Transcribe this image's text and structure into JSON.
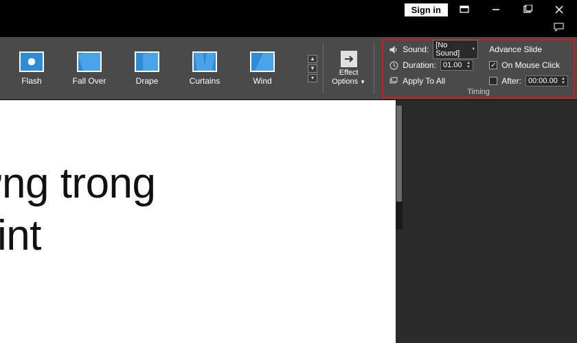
{
  "titlebar": {
    "signin_label": "Sign in"
  },
  "ribbon": {
    "transitions": [
      {
        "label": "Flash",
        "kind": "flash"
      },
      {
        "label": "Fall Over",
        "kind": "fallover"
      },
      {
        "label": "Drape",
        "kind": "drape"
      },
      {
        "label": "Curtains",
        "kind": "curtains"
      },
      {
        "label": "Wind",
        "kind": "wind"
      }
    ],
    "effect_options": {
      "line1": "Effect",
      "line2": "Options"
    },
    "timing": {
      "sound_label": "Sound:",
      "sound_value": "[No Sound]",
      "duration_label": "Duration:",
      "duration_value": "01.00",
      "apply_all_label": "Apply To All",
      "advance_heading": "Advance Slide",
      "on_mouse_label": "On Mouse Click",
      "on_mouse_checked": true,
      "after_label": "After:",
      "after_checked": false,
      "after_value": "00:00.00",
      "group_label": "Timing"
    }
  },
  "slide": {
    "line1": "ứng trong",
    "line2": "oint"
  }
}
